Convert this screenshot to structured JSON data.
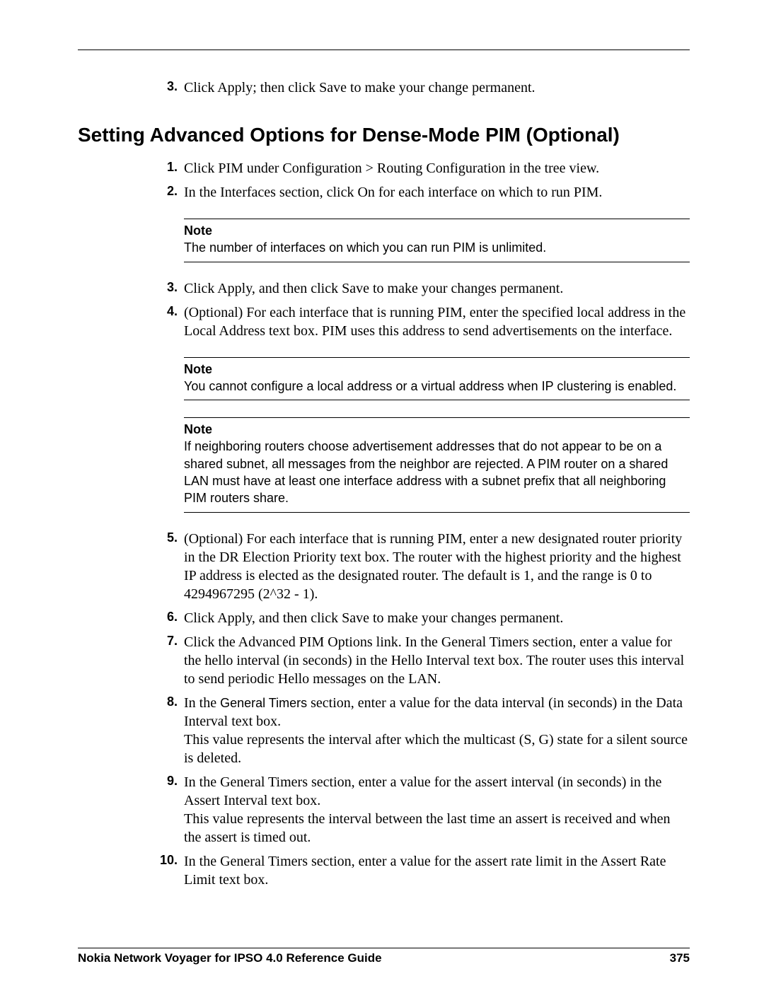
{
  "pre": {
    "step3": {
      "num": "3.",
      "text": "Click Apply; then click Save to make your change permanent."
    }
  },
  "heading": "Setting Advanced Options for Dense-Mode PIM (Optional)",
  "steps": {
    "s1": {
      "num": "1.",
      "text": "Click PIM under Configuration > Routing Configuration in the tree view."
    },
    "s2": {
      "num": "2.",
      "text": "In the Interfaces section, click On for each interface on which to run PIM."
    },
    "s3": {
      "num": "3.",
      "text": "Click Apply, and then click Save to make your changes permanent."
    },
    "s4": {
      "num": "4.",
      "text": "(Optional) For each interface that is running PIM, enter the specified local address in the Local Address text box. PIM uses this address to send advertisements on the interface."
    },
    "s5": {
      "num": "5.",
      "text": "(Optional) For each interface that is running PIM, enter a new designated router priority in the DR Election Priority text box. The router with the highest priority and the highest IP address is elected as the designated router. The default is 1, and the range is 0 to 4294967295 (2^32 - 1)."
    },
    "s6": {
      "num": "6.",
      "text": "Click Apply, and then click Save to make your changes permanent."
    },
    "s7": {
      "num": "7.",
      "text": "Click the Advanced PIM Options link. In the General Timers section, enter a value for the hello interval (in seconds) in the Hello Interval text box. The router uses this interval to send periodic Hello messages on the LAN."
    },
    "s8": {
      "num": "8.",
      "pre": "In the ",
      "mid": "General Timers ",
      "post": "section, enter a value for the data interval (in seconds) in the Data Interval text box.",
      "line2": "This value represents the interval after which the multicast (S, G) state for a silent source is deleted."
    },
    "s9": {
      "num": "9.",
      "text": "In the General Timers section, enter a value for the assert interval (in seconds) in the Assert Interval text box.",
      "line2": "This value represents the interval between the last time an assert is received and when the assert is timed out."
    },
    "s10": {
      "num": "10.",
      "text": "In the General Timers section, enter a value for the assert rate limit in the Assert Rate Limit text box."
    }
  },
  "notes": {
    "n1": {
      "title": "Note",
      "body": "The number of interfaces on which you can run PIM is unlimited."
    },
    "n2": {
      "title": "Note",
      "body": "You cannot configure a local address or a virtual address when IP clustering is enabled."
    },
    "n3": {
      "title": "Note",
      "body": "If neighboring routers choose advertisement addresses that do not appear to be on a shared subnet, all messages from the neighbor are rejected. A PIM router on a shared LAN must have at least one interface address with a subnet prefix that all neighboring PIM routers share."
    }
  },
  "footer": {
    "left": "Nokia Network Voyager for IPSO 4.0 Reference Guide",
    "right": "375"
  }
}
